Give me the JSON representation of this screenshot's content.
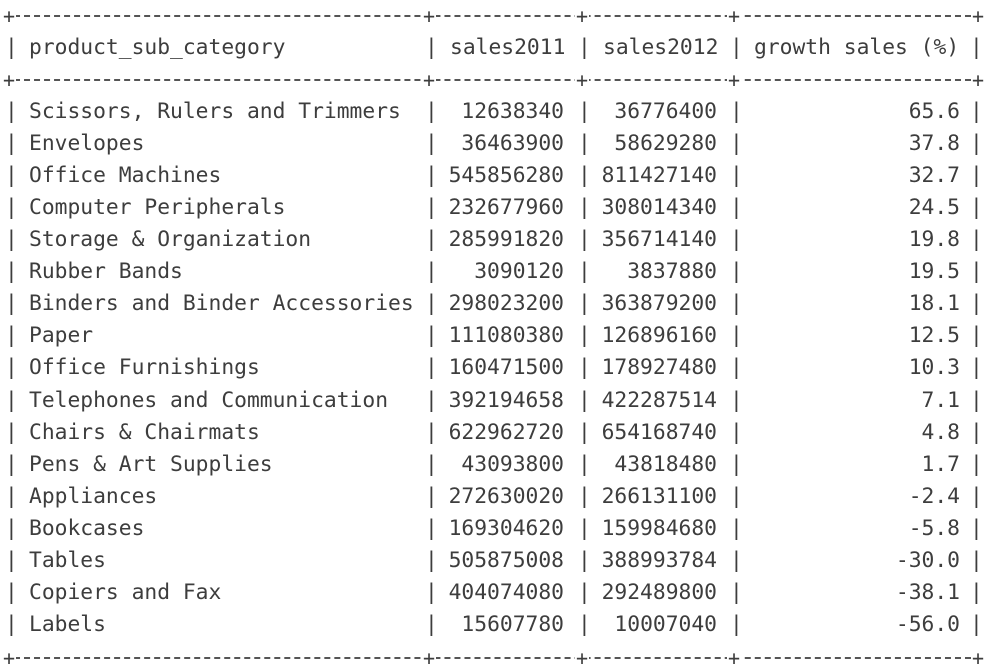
{
  "table": {
    "headers": {
      "product_sub_category": "product_sub_category",
      "sales2011": "sales2011",
      "sales2012": "sales2012",
      "growth": "growth sales (%)"
    },
    "rows": [
      {
        "product_sub_category": "Scissors, Rulers and Trimmers",
        "sales2011": "12638340",
        "sales2012": "36776400",
        "growth": "65.6"
      },
      {
        "product_sub_category": "Envelopes",
        "sales2011": "36463900",
        "sales2012": "58629280",
        "growth": "37.8"
      },
      {
        "product_sub_category": "Office Machines",
        "sales2011": "545856280",
        "sales2012": "811427140",
        "growth": "32.7"
      },
      {
        "product_sub_category": "Computer Peripherals",
        "sales2011": "232677960",
        "sales2012": "308014340",
        "growth": "24.5"
      },
      {
        "product_sub_category": "Storage & Organization",
        "sales2011": "285991820",
        "sales2012": "356714140",
        "growth": "19.8"
      },
      {
        "product_sub_category": "Rubber Bands",
        "sales2011": "3090120",
        "sales2012": "3837880",
        "growth": "19.5"
      },
      {
        "product_sub_category": "Binders and Binder Accessories",
        "sales2011": "298023200",
        "sales2012": "363879200",
        "growth": "18.1"
      },
      {
        "product_sub_category": "Paper",
        "sales2011": "111080380",
        "sales2012": "126896160",
        "growth": "12.5"
      },
      {
        "product_sub_category": "Office Furnishings",
        "sales2011": "160471500",
        "sales2012": "178927480",
        "growth": "10.3"
      },
      {
        "product_sub_category": "Telephones and Communication",
        "sales2011": "392194658",
        "sales2012": "422287514",
        "growth": "7.1"
      },
      {
        "product_sub_category": "Chairs & Chairmats",
        "sales2011": "622962720",
        "sales2012": "654168740",
        "growth": "4.8"
      },
      {
        "product_sub_category": "Pens & Art Supplies",
        "sales2011": "43093800",
        "sales2012": "43818480",
        "growth": "1.7"
      },
      {
        "product_sub_category": "Appliances",
        "sales2011": "272630020",
        "sales2012": "266131100",
        "growth": "-2.4"
      },
      {
        "product_sub_category": "Bookcases",
        "sales2011": "169304620",
        "sales2012": "159984680",
        "growth": "-5.8"
      },
      {
        "product_sub_category": "Tables",
        "sales2011": "505875008",
        "sales2012": "388993784",
        "growth": "-30.0"
      },
      {
        "product_sub_category": "Copiers and Fax",
        "sales2011": "404074080",
        "sales2012": "292489800",
        "growth": "-38.1"
      },
      {
        "product_sub_category": "Labels",
        "sales2011": "15607780",
        "sales2012": "10007040",
        "growth": "-56.0"
      }
    ]
  }
}
